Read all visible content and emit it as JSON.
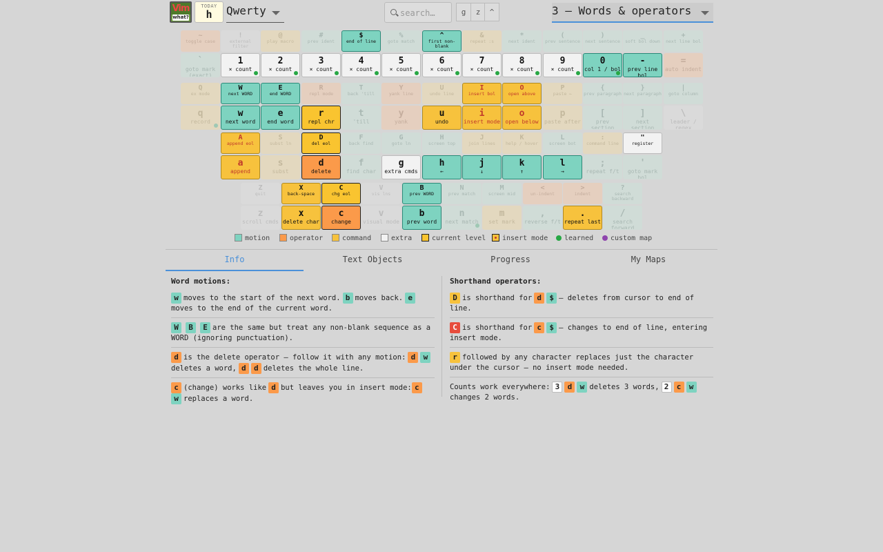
{
  "header": {
    "logo_text": "Vim",
    "logo_sub": "what?",
    "today_label": "TODAY",
    "today_key": "h",
    "layout": "Qwerty",
    "search_placeholder": "search…",
    "toggle_buttons": [
      "g",
      "z",
      "^"
    ],
    "level": "3 — Words & operators",
    "level_underline_color": "#4a90d9"
  },
  "keys": {
    "tilde": {
      "k": "~",
      "d": "toggle case"
    },
    "bang": {
      "k": "!",
      "d": "external filter"
    },
    "at": {
      "k": "@",
      "d": "play macro"
    },
    "hash": {
      "k": "#",
      "d": "prev ident"
    },
    "dollar": {
      "k": "$",
      "d": "end of line"
    },
    "percent": {
      "k": "%",
      "d": "goto match"
    },
    "caret": {
      "k": "^",
      "d": "first non-blank"
    },
    "amp": {
      "k": "&",
      "d": "repeat :s"
    },
    "star": {
      "k": "*",
      "d": "next ident"
    },
    "lparen": {
      "k": "(",
      "d": "prev sentence"
    },
    "rparen": {
      "k": ")",
      "d": "next sentence"
    },
    "underscore": {
      "k": "_",
      "d": "soft bol down"
    },
    "plus": {
      "k": "+",
      "d": "next line bol"
    },
    "backtick": {
      "k": "`",
      "d": "goto mark (exact)"
    },
    "n1": {
      "k": "1",
      "d": "× count"
    },
    "n2": {
      "k": "2",
      "d": "× count"
    },
    "n3": {
      "k": "3",
      "d": "× count"
    },
    "n4": {
      "k": "4",
      "d": "× count"
    },
    "n5": {
      "k": "5",
      "d": "× count"
    },
    "n6": {
      "k": "6",
      "d": "× count"
    },
    "n7": {
      "k": "7",
      "d": "× count"
    },
    "n8": {
      "k": "8",
      "d": "× count"
    },
    "n9": {
      "k": "9",
      "d": "× count"
    },
    "n0": {
      "k": "0",
      "d": "col 1 / bol"
    },
    "minus": {
      "k": "-",
      "d": "prev line bol"
    },
    "equals": {
      "k": "=",
      "d": "auto indent"
    },
    "Q": {
      "k": "Q",
      "d": "ex mode"
    },
    "W": {
      "k": "W",
      "d": "next WORD"
    },
    "E": {
      "k": "E",
      "d": "end WORD"
    },
    "R": {
      "k": "R",
      "d": "repl mode"
    },
    "T": {
      "k": "T",
      "d": "back 'till"
    },
    "Y": {
      "k": "Y",
      "d": "yank line"
    },
    "U": {
      "k": "U",
      "d": "undo line"
    },
    "I": {
      "k": "I",
      "d": "insert bol"
    },
    "O": {
      "k": "O",
      "d": "open above"
    },
    "P": {
      "k": "P",
      "d": "paste ←"
    },
    "lbrace": {
      "k": "{",
      "d": "prev paragraph"
    },
    "rbrace": {
      "k": "}",
      "d": "next paragraph"
    },
    "pipe": {
      "k": "|",
      "d": "goto column"
    },
    "q": {
      "k": "q",
      "d": "record"
    },
    "w": {
      "k": "w",
      "d": "next word"
    },
    "e": {
      "k": "e",
      "d": "end word"
    },
    "r": {
      "k": "r",
      "d": "repl chr"
    },
    "t": {
      "k": "t",
      "d": "'till"
    },
    "y": {
      "k": "y",
      "d": "yank"
    },
    "u": {
      "k": "u",
      "d": "undo"
    },
    "i": {
      "k": "i",
      "d": "insert mode"
    },
    "o": {
      "k": "o",
      "d": "open below"
    },
    "p": {
      "k": "p",
      "d": "paste after"
    },
    "lbracket": {
      "k": "[",
      "d": "prev section"
    },
    "rbracket": {
      "k": "]",
      "d": "next section"
    },
    "backslash": {
      "k": "\\",
      "d": "leader / regex"
    },
    "A": {
      "k": "A",
      "d": "append eol"
    },
    "S": {
      "k": "S",
      "d": "subst ln"
    },
    "D": {
      "k": "D",
      "d": "del eol"
    },
    "F": {
      "k": "F",
      "d": "back find"
    },
    "G": {
      "k": "G",
      "d": "goto ln"
    },
    "H": {
      "k": "H",
      "d": "screen top"
    },
    "J": {
      "k": "J",
      "d": "join lines"
    },
    "K": {
      "k": "K",
      "d": "help / hover"
    },
    "L": {
      "k": "L",
      "d": "screen bot"
    },
    "colon": {
      "k": ":",
      "d": "command line"
    },
    "dquote": {
      "k": "\"",
      "d": "register"
    },
    "a": {
      "k": "a",
      "d": "append"
    },
    "s": {
      "k": "s",
      "d": "subst"
    },
    "d": {
      "k": "d",
      "d": "delete"
    },
    "f": {
      "k": "f",
      "d": "find char"
    },
    "g": {
      "k": "g",
      "d": "extra cmds"
    },
    "h": {
      "k": "h",
      "d": "←"
    },
    "j": {
      "k": "j",
      "d": "↓"
    },
    "k": {
      "k": "k",
      "d": "↑"
    },
    "l": {
      "k": "l",
      "d": "→"
    },
    "semicolon": {
      "k": ";",
      "d": "repeat f/t"
    },
    "quote": {
      "k": "'",
      "d": "goto mark bol"
    },
    "Z": {
      "k": "Z",
      "d": "quit"
    },
    "X": {
      "k": "X",
      "d": "back-space"
    },
    "C": {
      "k": "C",
      "d": "chg eol"
    },
    "V": {
      "k": "V",
      "d": "vis lns"
    },
    "B": {
      "k": "B",
      "d": "prev WORD"
    },
    "N": {
      "k": "N",
      "d": "prev match"
    },
    "M": {
      "k": "M",
      "d": "screen mid"
    },
    "lt": {
      "k": "<",
      "d": "un-indent"
    },
    "gt": {
      "k": ">",
      "d": "indent"
    },
    "question": {
      "k": "?",
      "d": "search backward"
    },
    "z": {
      "k": "z",
      "d": "scroll cmds"
    },
    "x": {
      "k": "x",
      "d": "delete char"
    },
    "c": {
      "k": "c",
      "d": "change"
    },
    "v": {
      "k": "v",
      "d": "visual mode"
    },
    "b": {
      "k": "b",
      "d": "prev word"
    },
    "n": {
      "k": "n",
      "d": "next match"
    },
    "m": {
      "k": "m",
      "d": "set mark"
    },
    "comma": {
      "k": ",",
      "d": "reverse f/t"
    },
    "period": {
      "k": ".",
      "d": "repeat last"
    },
    "slash": {
      "k": "/",
      "d": "search forward"
    }
  },
  "legend": [
    {
      "label": "motion",
      "color": "#7ed3c0"
    },
    {
      "label": "operator",
      "color": "#fb9a4a"
    },
    {
      "label": "command",
      "color": "#f7c23d"
    },
    {
      "label": "extra",
      "color": "#f2f2f2"
    },
    {
      "label": "current level",
      "color": "#f9c430"
    },
    {
      "label": "insert mode",
      "color": "#f7c23d"
    },
    {
      "label": "learned",
      "color": "#27a744"
    },
    {
      "label": "custom map",
      "color": "#8e44ad"
    }
  ],
  "tabs": [
    "Info",
    "Text Objects",
    "Progress",
    "My Maps"
  ],
  "info": {
    "left_title": "Word motions:",
    "right_title": "Shorthand operators:",
    "l1": {
      "w": "w",
      "t1": "moves to the start of the next word.",
      "b": "b",
      "t2": "moves back.",
      "e": "e",
      "t3": "moves to the end of the current word."
    },
    "l2": {
      "W": "W",
      "B": "B",
      "E": "E",
      "t1": "are the same but treat any non-blank sequence as a WORD (ignoring punctuation)."
    },
    "l3": {
      "d": "d",
      "t1": "is the delete operator — follow it with any motion:",
      "d2": "d",
      "w": "w",
      "t2": "deletes a word,",
      "d3": "d",
      "d4": "d",
      "t3": "deletes the whole line."
    },
    "l4": {
      "c": "c",
      "t1": "(change) works like",
      "d": "d",
      "t2": "but leaves you in insert mode:",
      "c2": "c",
      "w": "w",
      "t3": "replaces a word."
    },
    "r1": {
      "D": "D",
      "t1": "is shorthand for",
      "d": "d",
      "s": "$",
      "t2": "— deletes from cursor to end of line."
    },
    "r2": {
      "C": "C",
      "t1": "is shorthand for",
      "c": "c",
      "s": "$",
      "t2": "— changes to end of line, entering insert mode."
    },
    "r3": {
      "r": "r",
      "t1": "followed by any character replaces just the character under the cursor — no insert mode needed."
    },
    "r4": {
      "t1": "Counts work everywhere:",
      "n3": "3",
      "d": "d",
      "w": "w",
      "t2": "deletes 3 words,",
      "n2": "2",
      "c": "c",
      "w2": "w",
      "t3": "changes 2 words."
    }
  }
}
